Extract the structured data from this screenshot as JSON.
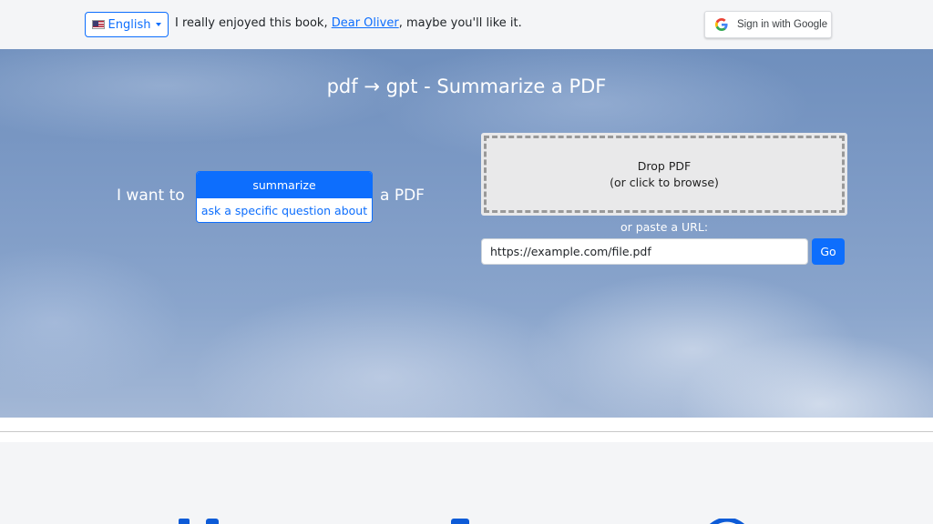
{
  "header": {
    "language_label": "English",
    "language_flag": "us-flag-icon",
    "share_prefix": "I really enjoyed this book, ",
    "share_link": "Dear Oliver",
    "share_suffix": ", maybe you'll like it.",
    "google_signin_label": "Sign in with Google"
  },
  "hero": {
    "title": "pdf → gpt - Summarize a PDF",
    "intent_prefix": "I want to",
    "intent_suffix": "a PDF",
    "intent_options": [
      {
        "label": "summarize",
        "selected": true
      },
      {
        "label": "ask a specific question about",
        "selected": false
      }
    ],
    "dropzone_line1": "Drop PDF",
    "dropzone_line2": "(or click to browse)",
    "paste_label": "or paste a URL:",
    "url_value": "https://example.com/file.pdf",
    "go_label": "Go"
  },
  "colors": {
    "accent": "#0d6efd",
    "sky_top": "#6f8fbd",
    "sky_bottom": "#a4b8d6"
  },
  "icons": [
    "us-flag-icon",
    "caret-down-icon",
    "google-logo-icon",
    "feature-icon-left",
    "feature-icon-middle",
    "feature-icon-right"
  ]
}
